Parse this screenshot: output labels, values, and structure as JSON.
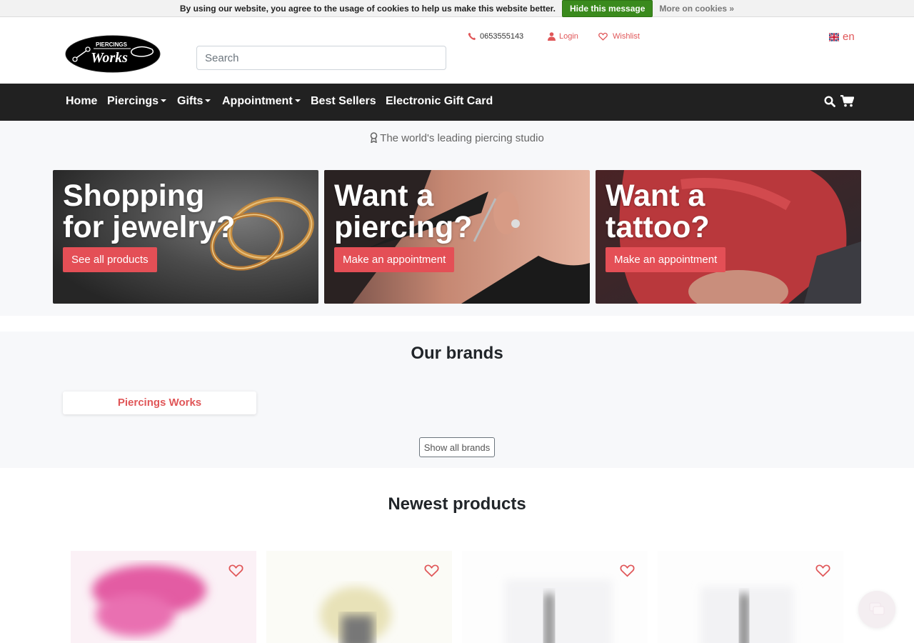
{
  "cookie": {
    "message": "By using our website, you agree to the usage of cookies to help us make this website better.",
    "hide_label": "Hide this message",
    "more_label": "More on cookies »"
  },
  "header": {
    "logo_alt": "Piercings Works",
    "logo_top": "PIERCINGS",
    "logo_main": "Works",
    "search_placeholder": "Search",
    "phone": "0653555143",
    "login": "Login",
    "wishlist": "Wishlist",
    "language": "en"
  },
  "nav": {
    "items": [
      {
        "label": "Home",
        "dropdown": false
      },
      {
        "label": "Piercings",
        "dropdown": true
      },
      {
        "label": "Gifts",
        "dropdown": true
      },
      {
        "label": "Appointment",
        "dropdown": true
      },
      {
        "label": "Best Sellers",
        "dropdown": false
      },
      {
        "label": "Electronic Gift Card",
        "dropdown": false
      }
    ],
    "icons": [
      "search-icon",
      "cart-icon"
    ]
  },
  "hero": {
    "tagline": "The world's leading piercing studio",
    "cards": [
      {
        "line1": "Shopping",
        "line2": "for jewelry?",
        "button": "See all products"
      },
      {
        "line1": "Want a",
        "line2": "piercing?",
        "button": "Make an appointment"
      },
      {
        "line1": "Want a",
        "line2": "tattoo?",
        "button": "Make an appointment"
      }
    ]
  },
  "brands": {
    "title": "Our brands",
    "items": [
      "Piercings Works"
    ],
    "show_all": "Show all brands"
  },
  "products": {
    "title": "Newest products"
  },
  "colors": {
    "accent": "#e44f56",
    "nav_bg": "#212121",
    "cookie_button": "#3a8a1d"
  }
}
